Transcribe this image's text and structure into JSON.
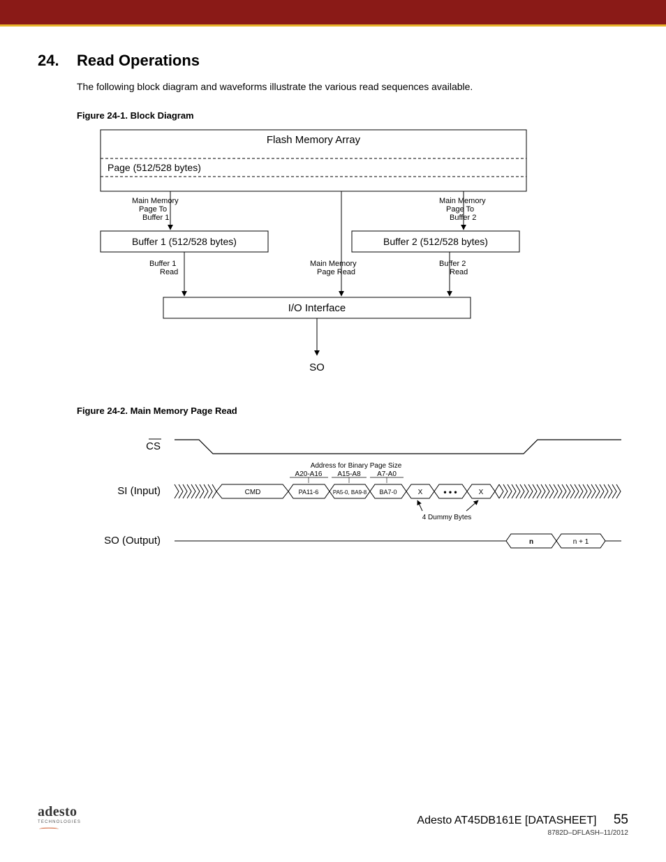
{
  "header": {
    "section_number": "24.",
    "section_title": "Read Operations",
    "intro": "The following block diagram and waveforms illustrate the various read sequences available."
  },
  "figure1": {
    "caption": "Figure 24-1. Block Diagram",
    "flash_array": "Flash Memory Array",
    "page_label": "Page (512/528 bytes)",
    "arrow_mm_to_b1_l1": "Main Memory",
    "arrow_mm_to_b1_l2": "Page To",
    "arrow_mm_to_b1_l3": "Buffer 1",
    "arrow_mm_to_b2_l1": "Main Memory",
    "arrow_mm_to_b2_l2": "Page To",
    "arrow_mm_to_b2_l3": "Buffer 2",
    "buffer1": "Buffer 1 (512/528 bytes)",
    "buffer2": "Buffer 2 (512/528 bytes)",
    "b1_read_l1": "Buffer 1",
    "b1_read_l2": "Read",
    "mm_read_l1": "Main Memory",
    "mm_read_l2": "Page Read",
    "b2_read_l1": "Buffer 2",
    "b2_read_l2": "Read",
    "io_interface": "I/O Interface",
    "so": "SO"
  },
  "figure2": {
    "caption": "Figure 24-2. Main Memory Page Read",
    "cs_label": "CS",
    "si_label": "SI (Input)",
    "so_label": "SO (Output)",
    "addr_title": "Address for Binary Page Size",
    "addr_a": "A20-A16",
    "addr_b": "A15-A8",
    "addr_c": "A7-A0",
    "cmd": "CMD",
    "pa11": "PA11-6",
    "pa5": "PA5-0, BA9-8",
    "ba7": "BA7-0",
    "x": "X",
    "dummy": "4 Dummy Bytes",
    "n": "n",
    "n1": "n + 1"
  },
  "footer": {
    "logo_main": "adesto",
    "logo_sub": "TECHNOLOGIES",
    "doc_title": "Adesto AT45DB161E [DATASHEET]",
    "page_num": "55",
    "doc_id": "8782D–DFLASH–11/2012"
  }
}
